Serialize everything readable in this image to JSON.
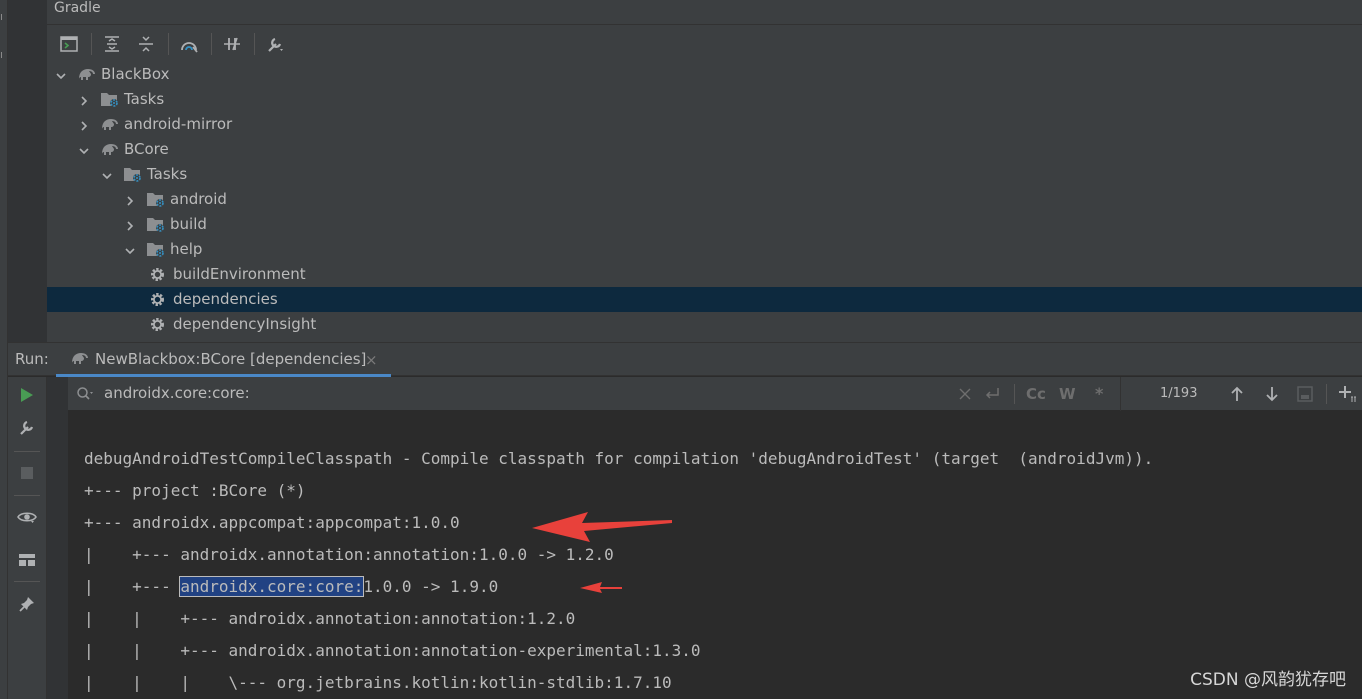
{
  "gradle": {
    "title": "Gradle",
    "tree": [
      {
        "label": "BlackBox",
        "level": 0,
        "expander": "expanded",
        "icon": "gradle-elephant-icon"
      },
      {
        "label": "Tasks",
        "level": 1,
        "expander": "collapsed",
        "icon": "task-folder-icon"
      },
      {
        "label": "android-mirror",
        "level": 1,
        "expander": "collapsed",
        "icon": "gradle-elephant-icon"
      },
      {
        "label": "BCore",
        "level": 1,
        "expander": "expanded",
        "icon": "gradle-elephant-icon"
      },
      {
        "label": "Tasks",
        "level": 2,
        "expander": "expanded",
        "icon": "task-folder-icon"
      },
      {
        "label": "android",
        "level": 3,
        "expander": "collapsed",
        "icon": "task-folder-icon"
      },
      {
        "label": "build",
        "level": 3,
        "expander": "collapsed",
        "icon": "task-folder-icon"
      },
      {
        "label": "help",
        "level": 3,
        "expander": "expanded",
        "icon": "task-folder-icon"
      },
      {
        "label": "buildEnvironment",
        "level": 4,
        "expander": "none",
        "icon": "gear-icon"
      },
      {
        "label": "dependencies",
        "level": 4,
        "expander": "none",
        "icon": "gear-icon",
        "selected": true
      },
      {
        "label": "dependencyInsight",
        "level": 4,
        "expander": "none",
        "icon": "gear-icon"
      }
    ]
  },
  "run": {
    "label": "Run:",
    "tab_title": "NewBlackbox:BCore [dependencies]",
    "tab_close": "×",
    "search_value": "androidx.core:core:",
    "match_count": "1/193",
    "toggle_case": "Cc",
    "toggle_words": "W",
    "toggle_regex": "*"
  },
  "console": {
    "lines": [
      "debugAndroidTestCompileClasspath - Compile classpath for compilation 'debugAndroidTest' (target  (androidJvm)).",
      "+--- project :BCore (*)",
      "+--- androidx.appcompat:appcompat:1.0.0",
      "|    +--- androidx.annotation:annotation:1.0.0 -> 1.2.0",
      "|    +--- androidx.core:core:1.0.0 -> 1.9.0",
      "|    |    +--- androidx.annotation:annotation:1.2.0",
      "|    |    +--- androidx.annotation:annotation-experimental:1.3.0",
      "|    |    |    \\--- org.jetbrains.kotlin:kotlin-stdlib:1.7.10"
    ],
    "highlight": {
      "line": 4,
      "prefix": "|    +--- ",
      "match": "androidx.core:core:",
      "suffix": "1.0.0 -> 1.9.0"
    }
  },
  "watermark": "CSDN @风韵犹存吧",
  "colors": {
    "selection": "#0d293e",
    "match_highlight": "#214283",
    "tab_underline": "#4a88c7",
    "arrow": "#e8413b",
    "run_green": "#499c54"
  }
}
